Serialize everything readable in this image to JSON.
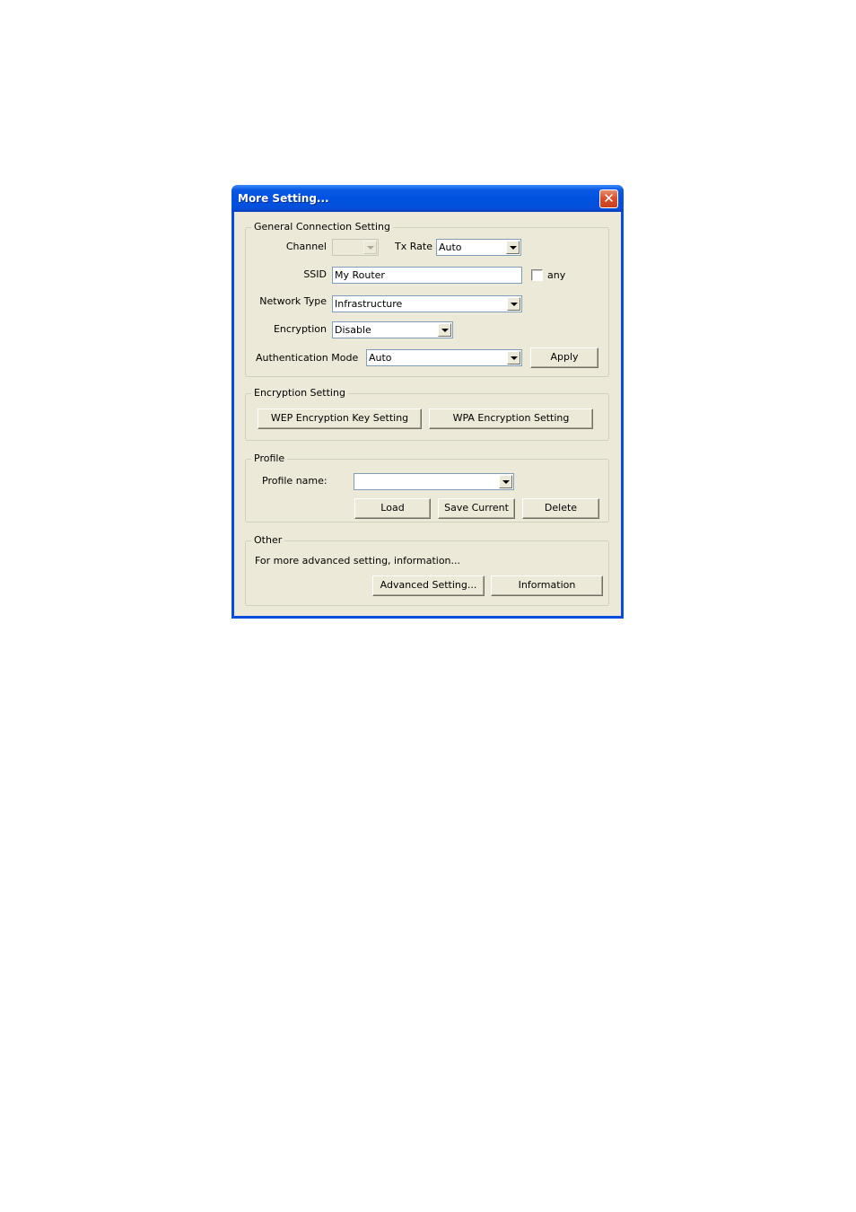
{
  "window": {
    "title": "More Setting...",
    "close_icon": "close-x-icon"
  },
  "general": {
    "legend": "General Connection Setting",
    "channel_label": "Channel",
    "channel_value": "",
    "channel_disabled": true,
    "tx_rate_label": "Tx Rate",
    "tx_rate_value": "Auto",
    "ssid_label": "SSID",
    "ssid_value": "My Router",
    "any_label": "any",
    "any_checked": false,
    "network_type_label": "Network Type",
    "network_type_value": "Infrastructure",
    "encryption_label": "Encryption",
    "encryption_value": "Disable",
    "auth_mode_label": "Authentication Mode",
    "auth_mode_value": "Auto",
    "apply_label": "Apply"
  },
  "encryption_setting": {
    "legend": "Encryption Setting",
    "wep_button": "WEP Encryption Key Setting",
    "wpa_button": "WPA Encryption Setting"
  },
  "profile": {
    "legend": "Profile",
    "name_label": "Profile name:",
    "name_value": "",
    "load_button": "Load",
    "save_button": "Save Current",
    "delete_button": "Delete"
  },
  "other": {
    "legend": "Other",
    "description": "For more advanced setting, information...",
    "advanced_button": "Advanced Setting...",
    "information_button": "Information"
  }
}
